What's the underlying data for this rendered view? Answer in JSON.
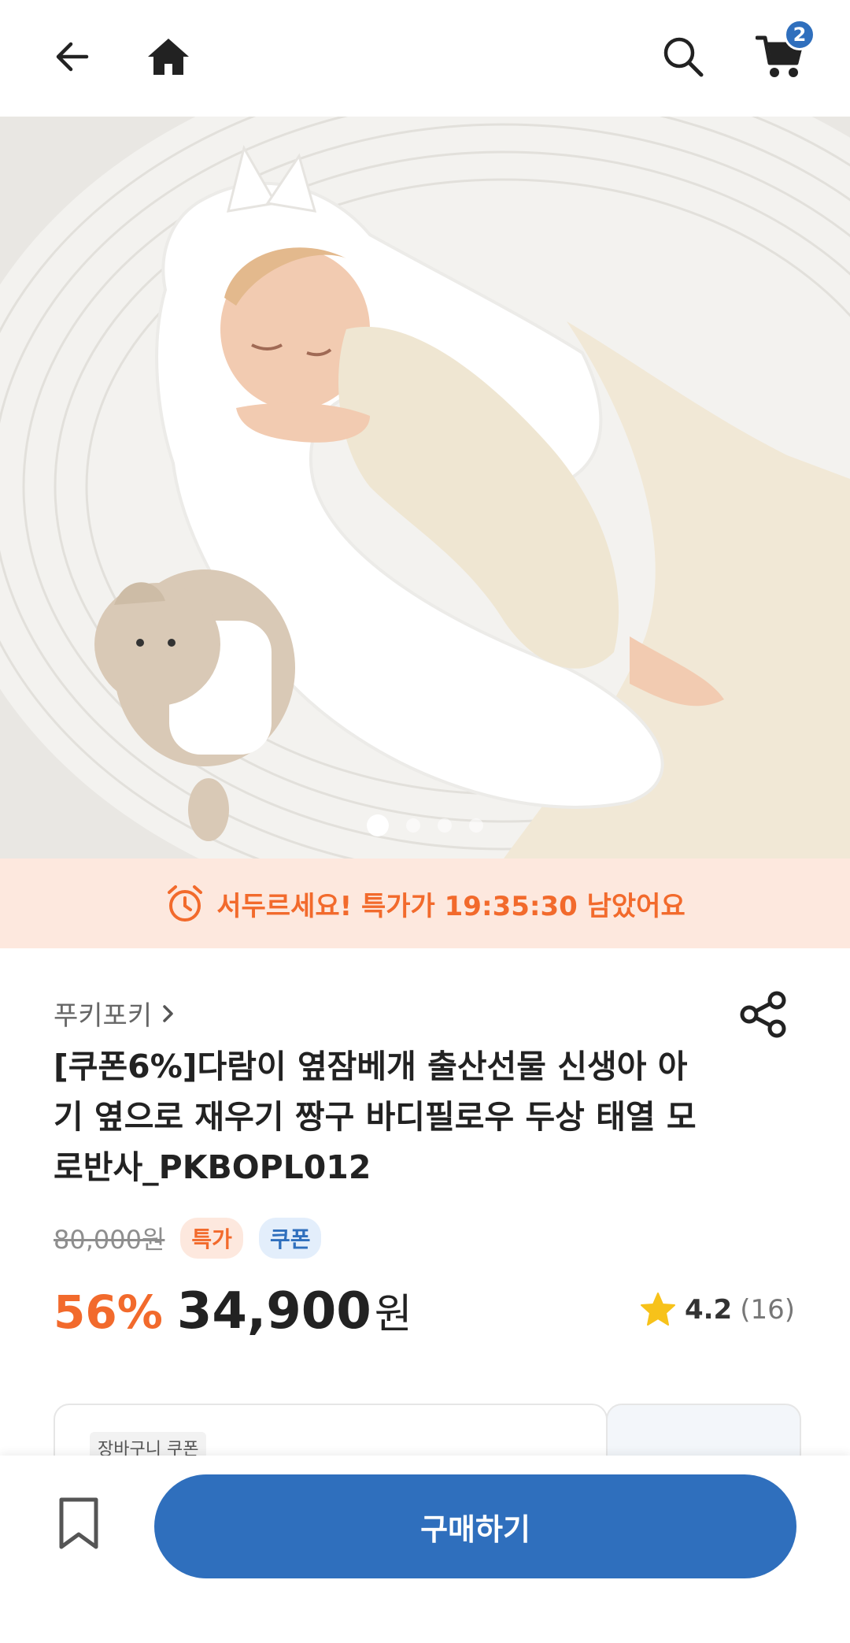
{
  "header": {
    "cart_count": "2"
  },
  "gallery": {
    "dots": 4,
    "active_index": 0
  },
  "timer": {
    "text": "서두르세요! 특가가 19:35:30 남았어요"
  },
  "product": {
    "seller": "푸키포키",
    "title": "[쿠폰6%]다람이 옆잠베개 출산선물 신생아 아기 옆으로 재우기 짱구 바디필로우 두상 태열 모로반사_PKBOPL012",
    "original_price": "80,000원",
    "tag_special": "특가",
    "tag_coupon": "쿠폰",
    "discount": "56%",
    "price": "34,900",
    "currency": "원",
    "rating": "4.2",
    "review_count": "(16)"
  },
  "coupon": {
    "label": "장바구니 쿠폰"
  },
  "bottom": {
    "buy_label": "구매하기"
  },
  "colors": {
    "accent_blue": "#2f6fbd",
    "accent_orange": "#f26a2c",
    "timer_bg": "#fde8de",
    "star": "#f7c21a"
  },
  "icons": {
    "back": "arrow-left-icon",
    "home": "home-icon",
    "search": "search-icon",
    "cart": "cart-icon",
    "alarm": "alarm-clock-icon",
    "chevron": "chevron-right-icon",
    "share": "share-icon",
    "star": "star-icon",
    "bookmark": "bookmark-icon"
  }
}
